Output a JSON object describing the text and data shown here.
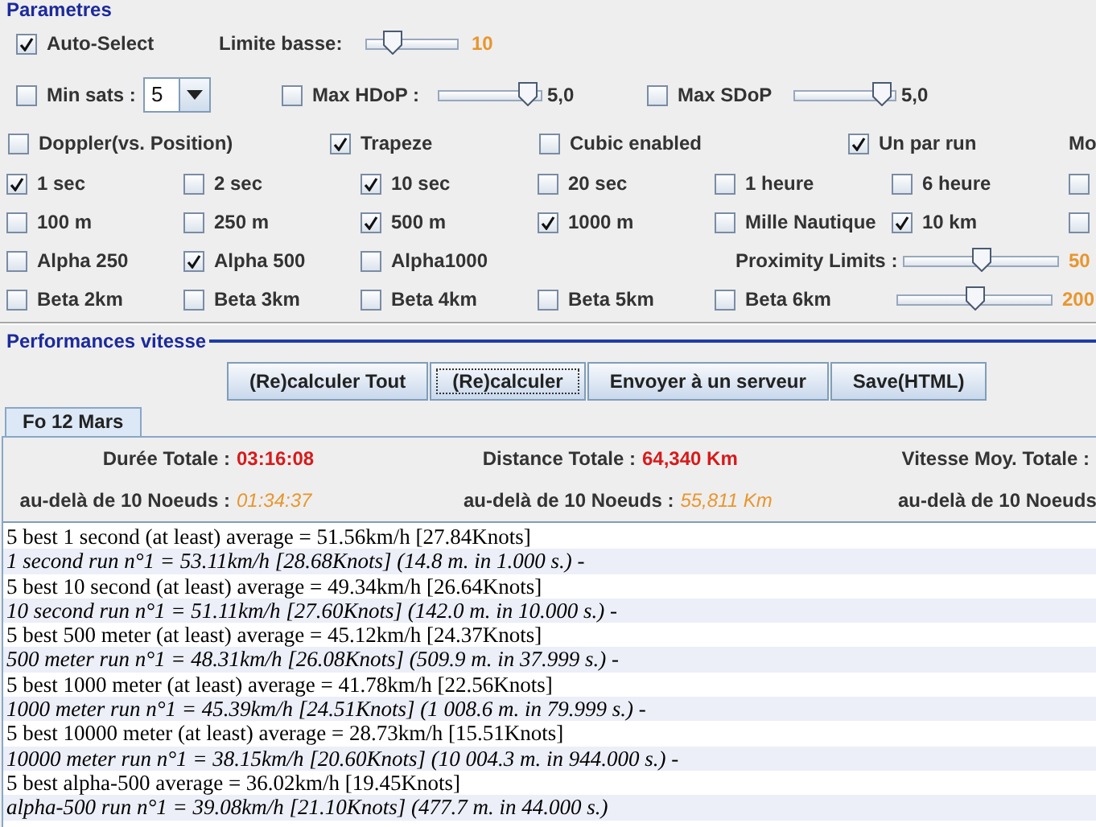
{
  "parameters": {
    "title": "Parametres",
    "auto_select": {
      "label": "Auto-Select",
      "checked": true
    },
    "limite_basse": {
      "label": "Limite basse:",
      "level": 0.29,
      "reading": "10"
    },
    "min_sats": {
      "label": "Min sats :",
      "checked": false,
      "value": "5"
    },
    "max_hdop": {
      "label": "Max HDoP :",
      "checked": false,
      "level": 0.87,
      "reading": "5,0"
    },
    "max_sdop": {
      "label": "Max SDoP",
      "checked": false,
      "level": 0.87,
      "reading": "5,0"
    },
    "options": [
      {
        "label": "Doppler(vs. Position)",
        "checked": false
      },
      {
        "label": "Trapeze",
        "checked": true
      },
      {
        "label": "Cubic enabled",
        "checked": false
      },
      {
        "label": "Un par run",
        "checked": true
      },
      {
        "label": "Mo"
      }
    ],
    "durations": [
      {
        "label": "1 sec",
        "checked": true
      },
      {
        "label": "2 sec",
        "checked": false
      },
      {
        "label": "10 sec",
        "checked": true
      },
      {
        "label": "20 sec",
        "checked": false
      },
      {
        "label": "1 heure",
        "checked": false
      },
      {
        "label": "6 heure",
        "checked": false
      },
      {
        "checked": false
      }
    ],
    "distances": [
      {
        "label": "100 m",
        "checked": false
      },
      {
        "label": "250 m",
        "checked": false
      },
      {
        "label": "500 m",
        "checked": true
      },
      {
        "label": "1000 m",
        "checked": true
      },
      {
        "label": "Mille Nautique",
        "checked": false
      },
      {
        "label": "10 km",
        "checked": true
      },
      {
        "checked": false
      }
    ],
    "alphas": [
      {
        "label": "Alpha 250",
        "checked": false
      },
      {
        "label": "Alpha 500",
        "checked": true
      },
      {
        "label": "Alpha1000",
        "checked": false
      }
    ],
    "betas": [
      {
        "label": "Beta 2km",
        "checked": false
      },
      {
        "label": "Beta 3km",
        "checked": false
      },
      {
        "label": "Beta 4km",
        "checked": false
      },
      {
        "label": "Beta 5km",
        "checked": false
      },
      {
        "label": "Beta 6km",
        "checked": false
      }
    ],
    "proximity": {
      "label": "Proximity Limits :",
      "sliders": [
        {
          "level": 0.5,
          "reading": "50"
        },
        {
          "level": 0.5,
          "reading": "200"
        }
      ]
    }
  },
  "performances": {
    "title": "Performances vitesse",
    "buttons": [
      {
        "label": "(Re)calculer Tout",
        "focused": false
      },
      {
        "label": "(Re)calculer",
        "focused": true
      },
      {
        "label": "Envoyer à un serveur",
        "focused": false
      },
      {
        "label": "Save(HTML)",
        "focused": false
      }
    ],
    "tabs": [
      {
        "label": "Fo 12 Mars",
        "selected": true
      }
    ],
    "totals": [
      {
        "label": "Durée Totale :",
        "value": "03:16:08"
      },
      {
        "label": "Distance Totale :",
        "value": "64,340 Km"
      },
      {
        "label": "Vitesse Moy. Totale :"
      }
    ],
    "above": [
      {
        "label": "au-delà de  10 Noeuds :",
        "value": "01:34:37"
      },
      {
        "label": "au-delà de  10 Noeuds :",
        "value": "55,811 Km"
      },
      {
        "label": "au-delà de  10 Noeuds"
      }
    ],
    "results": [
      {
        "kind": "summary",
        "text": "5 best 1 second (at least) average = 51.56km/h [27.84Knots]"
      },
      {
        "kind": "run",
        "text": "1 second run n°1 = 53.11km/h [28.68Knots] (14.8 m. in 1.000 s.) -"
      },
      {
        "kind": "summary",
        "text": "5 best 10 second (at least) average = 49.34km/h [26.64Knots]"
      },
      {
        "kind": "run",
        "text": "10 second run n°1 = 51.11km/h [27.60Knots] (142.0 m. in 10.000 s.) -"
      },
      {
        "kind": "summary",
        "text": "5 best 500 meter (at least) average = 45.12km/h [24.37Knots]"
      },
      {
        "kind": "run",
        "text": "500 meter run n°1 = 48.31km/h [26.08Knots] (509.9 m. in 37.999 s.) -"
      },
      {
        "kind": "summary",
        "text": "5 best 1000 meter (at least) average = 41.78km/h [22.56Knots]"
      },
      {
        "kind": "run",
        "text": "1000 meter run n°1 = 45.39km/h [24.51Knots] (1 008.6 m. in 79.999 s.) -"
      },
      {
        "kind": "summary",
        "text": "5 best 10000 meter (at least) average = 28.73km/h [15.51Knots]"
      },
      {
        "kind": "run",
        "text": "10000 meter run n°1 = 38.15km/h [20.60Knots] (10 004.3 m. in 944.000 s.) -"
      },
      {
        "kind": "summary",
        "text": "5 best alpha-500 average = 36.02km/h [19.45Knots]"
      },
      {
        "kind": "run",
        "text": "alpha-500 run n°1 = 39.08km/h [21.10Knots] (477.7 m. in 44.000 s.)"
      }
    ]
  }
}
